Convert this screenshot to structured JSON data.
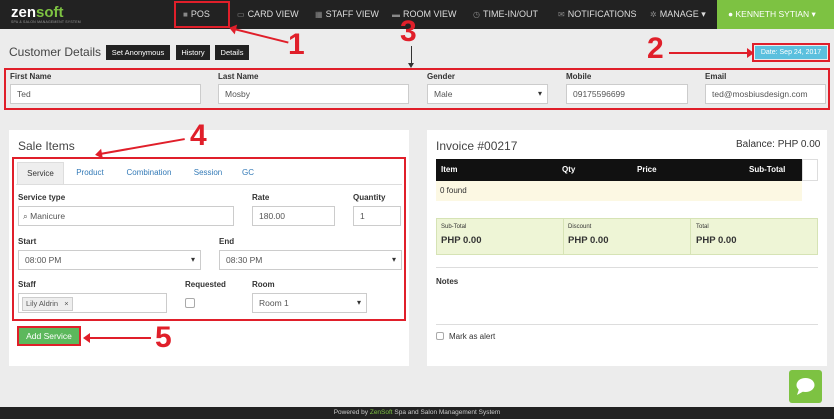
{
  "app": {
    "logo_prefix": "zen",
    "logo_suffix": "soft",
    "tagline": "SPA & SALON MANAGEMENT SYSTEM"
  },
  "nav": {
    "items": [
      {
        "label": "POS",
        "icon": "pos-icon"
      },
      {
        "label": "CARD VIEW",
        "icon": "card-icon"
      },
      {
        "label": "STAFF VIEW",
        "icon": "calendar-icon"
      },
      {
        "label": "ROOM VIEW",
        "icon": "bed-icon"
      },
      {
        "label": "TIME-IN/OUT",
        "icon": "clock-icon"
      },
      {
        "label": "NOTIFICATIONS",
        "icon": "bell-icon"
      },
      {
        "label": "MANAGE ▾",
        "icon": "gear-icon"
      }
    ],
    "user": "KENNETH SYTIAN ▾"
  },
  "customer": {
    "title": "Customer Details",
    "buttons": {
      "anonymous": "Set Anonymous",
      "history": "History",
      "details": "Details"
    },
    "date": "Date: Sep 24, 2017",
    "fields": {
      "first_name": {
        "label": "First Name",
        "value": "Ted"
      },
      "last_name": {
        "label": "Last Name",
        "value": "Mosby"
      },
      "gender": {
        "label": "Gender",
        "value": "Male"
      },
      "mobile": {
        "label": "Mobile",
        "value": "09175596699"
      },
      "email": {
        "label": "Email",
        "value": "ted@mosbiusdesign.com"
      }
    }
  },
  "sale": {
    "title": "Sale Items",
    "tabs": [
      "Service",
      "Product",
      "Combination",
      "Session",
      "GC"
    ],
    "service_type": {
      "label": "Service type",
      "value": "Manicure"
    },
    "rate": {
      "label": "Rate",
      "value": "180.00"
    },
    "quantity": {
      "label": "Quantity",
      "value": "1"
    },
    "start": {
      "label": "Start",
      "value": "08:00 PM"
    },
    "end": {
      "label": "End",
      "value": "08:30 PM"
    },
    "staff": {
      "label": "Staff",
      "value": "Lily Aldrin",
      "remove": "×"
    },
    "requested": {
      "label": "Requested"
    },
    "room": {
      "label": "Room",
      "value": "Room 1"
    },
    "add_button": "Add Service"
  },
  "invoice": {
    "title": "Invoice #00217",
    "balance": "Balance: PHP 0.00",
    "columns": [
      "Item",
      "Qty",
      "Price",
      "Sub-Total"
    ],
    "empty": "0 found",
    "subtotal": {
      "label": "Sub-Total",
      "value": "PHP 0.00"
    },
    "discount": {
      "label": "Discount",
      "value": "PHP 0.00"
    },
    "total": {
      "label": "Total",
      "value": "PHP 0.00"
    },
    "notes_label": "Notes",
    "alert_label": "Mark as alert"
  },
  "annotations": [
    "1",
    "2",
    "3",
    "4",
    "5"
  ],
  "footer": {
    "prefix": "Powered by ",
    "brand": "ZenSoft",
    "suffix": " Spa and Salon Management System"
  },
  "colors": {
    "brand_green": "#7dc242",
    "nav_bg": "#222222",
    "annotation_red": "#e01f2a",
    "date_badge": "#5bc0de",
    "totals_bg": "#eef5d6"
  }
}
